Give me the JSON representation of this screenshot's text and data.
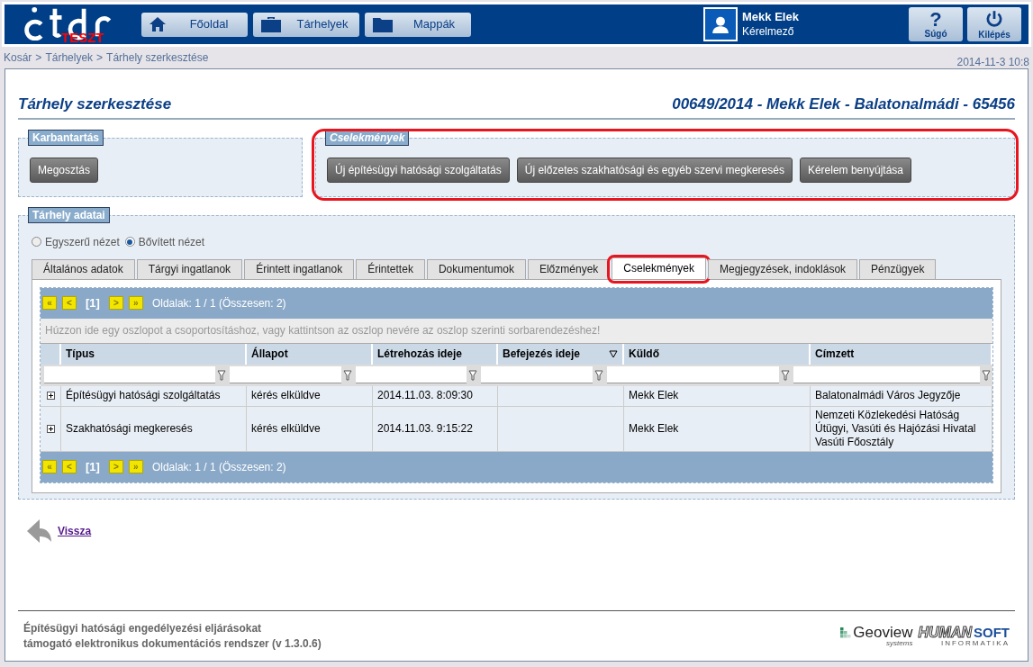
{
  "header": {
    "logo_badge": "TESZT",
    "nav": [
      {
        "label": "Főoldal"
      },
      {
        "label": "Tárhelyek"
      },
      {
        "label": "Mappák"
      }
    ],
    "user": {
      "name": "Mekk Elek",
      "role": "Kérelmező"
    },
    "actions": [
      {
        "label": "Súgó",
        "symbol": "?"
      },
      {
        "label": "Kilépés"
      }
    ]
  },
  "breadcrumb": [
    "Kosár",
    "Tárhelyek",
    "Tárhely szerkesztése"
  ],
  "breadcrumb_separator": ">",
  "datetime": "2014-11-3 10:8",
  "page_title": "Tárhely szerkesztése",
  "case_title": "00649/2014 - Mekk Elek - Balatonalmádi - 65456",
  "sections": [
    {
      "title": "Karbantartás",
      "italic": false,
      "highlighted": false,
      "buttons": [
        "Megosztás"
      ]
    },
    {
      "title": "Cselekmények",
      "italic": true,
      "highlighted": true,
      "buttons": [
        "Új építésügyi hatósági szolgáltatás",
        "Új előzetes szakhatósági és egyéb szervi megkeresés",
        "Kérelem benyújtása"
      ]
    }
  ],
  "data_panel": {
    "title": "Tárhely adatai",
    "views": [
      {
        "label": "Egyszerű nézet",
        "selected": false
      },
      {
        "label": "Bővített nézet",
        "selected": true
      }
    ],
    "tabs": [
      {
        "label": "Általános adatok",
        "selected": false,
        "highlighted": false
      },
      {
        "label": "Tárgyi ingatlanok",
        "selected": false,
        "highlighted": false
      },
      {
        "label": "Érintett ingatlanok",
        "selected": false,
        "highlighted": false
      },
      {
        "label": "Érintettek",
        "selected": false,
        "highlighted": false
      },
      {
        "label": "Dokumentumok",
        "selected": false,
        "highlighted": false
      },
      {
        "label": "Előzmények",
        "selected": false,
        "highlighted": false
      },
      {
        "label": "Cselekmények",
        "selected": true,
        "highlighted": true
      },
      {
        "label": "Megjegyzések, indoklások",
        "selected": false,
        "highlighted": false
      },
      {
        "label": "Pénzügyek",
        "selected": false,
        "highlighted": false
      }
    ],
    "pager_top": {
      "first": "«",
      "prev": "<",
      "current": "[1]",
      "next": ">",
      "last": "»",
      "info": "Oldalak: 1 / 1 (Összesen: 2)"
    },
    "pager_bottom": {
      "first": "«",
      "prev": "<",
      "current": "[1]",
      "next": ">",
      "last": "»",
      "info": "Oldalak: 1 / 1 (Összesen: 2)"
    },
    "group_hint": "Húzzon ide egy oszlopot a csoportosításhoz, vagy kattintson az oszlop nevére az oszlop szerinti sorbarendezéshez!",
    "table": {
      "columns": [
        {
          "label": "Típus",
          "sorted": false
        },
        {
          "label": "Állapot",
          "sorted": false
        },
        {
          "label": "Létrehozás ideje",
          "sorted": false
        },
        {
          "label": "Befejezés ideje",
          "sorted": true
        },
        {
          "label": "Küldő",
          "sorted": false
        },
        {
          "label": "Címzett",
          "sorted": false
        }
      ],
      "rows": [
        {
          "expanded": false,
          "cells": [
            "Építésügyi hatósági szolgáltatás",
            "kérés elküldve",
            "2014.11.03. 8:09:30",
            "",
            "Mekk Elek",
            "Balatonalmádi Város Jegyzője"
          ]
        },
        {
          "expanded": false,
          "cells": [
            "Szakhatósági megkeresés",
            "kérés elküldve",
            "2014.11.03. 9:15:22",
            "",
            "Mekk Elek",
            "Nemzeti Közlekedési Hatóság Útügyi, Vasúti és Hajózási Hivatal Vasúti Főosztály"
          ]
        }
      ]
    }
  },
  "back_link": "Vissza",
  "footer": {
    "lines": [
      "Építésügyi hatósági engedélyezési eljárásokat",
      "támogató elektronikus dokumentációs rendszer (v 1.3.0.6)"
    ],
    "logos": [
      {
        "name": "Geoview",
        "sub": "systems"
      },
      {
        "name": "HUMAN",
        "accent": "SOFT",
        "sub": "INFORMATIKA"
      }
    ]
  }
}
